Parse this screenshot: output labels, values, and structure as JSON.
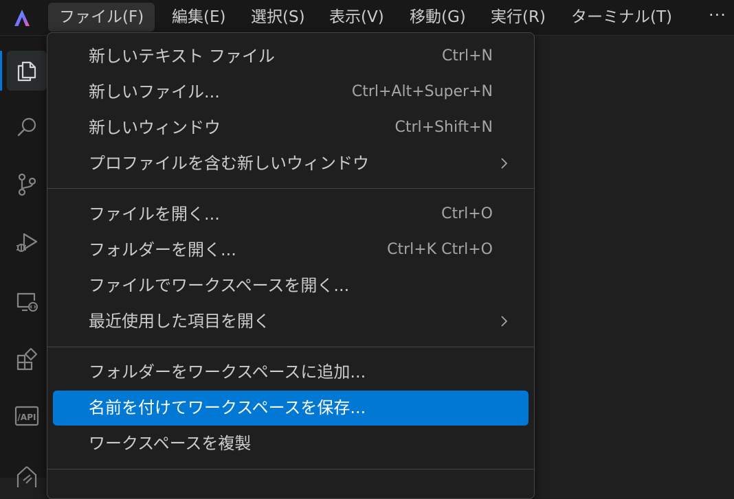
{
  "menubar": {
    "items": [
      {
        "label": "ファイル(F)",
        "active": true
      },
      {
        "label": "編集(E)"
      },
      {
        "label": "選択(S)"
      },
      {
        "label": "表示(V)"
      },
      {
        "label": "移動(G)"
      },
      {
        "label": "実行(R)"
      },
      {
        "label": "ターミナル(T)"
      }
    ],
    "more_icon": "ellipsis-icon",
    "logo_icon": "app-logo-icon"
  },
  "activitybar": {
    "items": [
      {
        "icon": "explorer-icon",
        "active": true
      },
      {
        "icon": "search-icon"
      },
      {
        "icon": "source-control-icon"
      },
      {
        "icon": "run-debug-icon"
      },
      {
        "icon": "remote-explorer-icon"
      },
      {
        "icon": "extensions-icon"
      },
      {
        "icon": "api-icon",
        "label": "/API"
      },
      {
        "icon": "partial-icon"
      }
    ]
  },
  "file_menu": {
    "groups": [
      [
        {
          "label": "新しいテキスト ファイル",
          "shortcut": "Ctrl+N"
        },
        {
          "label": "新しいファイル...",
          "shortcut": "Ctrl+Alt+Super+N"
        },
        {
          "label": "新しいウィンドウ",
          "shortcut": "Ctrl+Shift+N"
        },
        {
          "label": "プロファイルを含む新しいウィンドウ",
          "submenu": true
        }
      ],
      [
        {
          "label": "ファイルを開く...",
          "shortcut": "Ctrl+O"
        },
        {
          "label": "フォルダーを開く...",
          "shortcut": "Ctrl+K Ctrl+O"
        },
        {
          "label": "ファイルでワークスペースを開く..."
        },
        {
          "label": "最近使用した項目を開く",
          "submenu": true
        }
      ],
      [
        {
          "label": "フォルダーをワークスペースに追加..."
        },
        {
          "label": "名前を付けてワークスペースを保存...",
          "highlighted": true
        },
        {
          "label": "ワークスペースを複製"
        }
      ]
    ]
  },
  "colors": {
    "accent": "#0078d4",
    "background": "#1f1f1f",
    "menubar": "#181818",
    "text": "#cccccc",
    "shortcut_text": "#a6a6a6"
  }
}
